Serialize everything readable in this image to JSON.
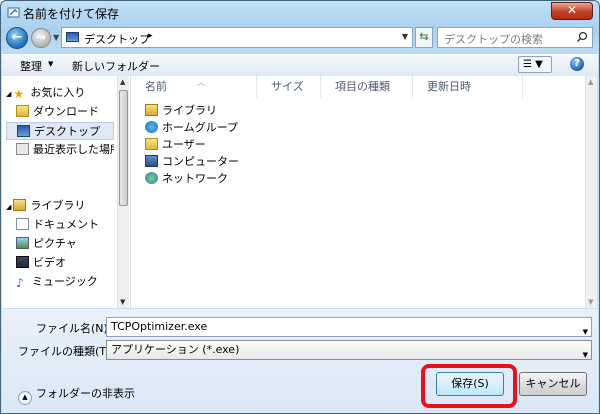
{
  "window": {
    "title": "名前を付けて保存",
    "close_label": "✕"
  },
  "address": {
    "location": "デスクトップ",
    "separator": "▸",
    "search_placeholder": "デスクトップの検索"
  },
  "toolbar": {
    "organize_label": "整理",
    "new_folder_label": "新しいフォルダー",
    "view_label": "☰",
    "help_label": "?"
  },
  "nav": {
    "favorites": [
      {
        "label": "お気に入り",
        "icon": "star-icon"
      },
      {
        "label": "ダウンロード",
        "icon": "download-folder-icon"
      },
      {
        "label": "デスクトップ",
        "icon": "desktop-icon",
        "selected": true
      },
      {
        "label": "最近表示した場所",
        "icon": "recent-places-icon"
      }
    ],
    "libraries": [
      {
        "label": "ライブラリ",
        "icon": "library-icon"
      },
      {
        "label": "ドキュメント",
        "icon": "documents-icon"
      },
      {
        "label": "ピクチャ",
        "icon": "pictures-icon"
      },
      {
        "label": "ビデオ",
        "icon": "videos-icon"
      },
      {
        "label": "ミュージック",
        "icon": "music-icon"
      }
    ]
  },
  "columns": [
    "名前",
    "サイズ",
    "項目の種類",
    "更新日時"
  ],
  "files": [
    {
      "label": "ライブラリ",
      "icon": "library-icon"
    },
    {
      "label": "ホームグループ",
      "icon": "homegroup-icon"
    },
    {
      "label": "ユーザー",
      "icon": "user-folder-icon"
    },
    {
      "label": "コンピューター",
      "icon": "computer-icon"
    },
    {
      "label": "ネットワーク",
      "icon": "network-icon"
    }
  ],
  "form": {
    "filename_label": "ファイル名(N):",
    "filename_value": "TCPOptimizer.exe",
    "filetype_label": "ファイルの種類(T):",
    "filetype_value": "アプリケーション (*.exe)",
    "hide_folders_label": "フォルダーの非表示",
    "save_label": "保存(S)",
    "cancel_label": "キャンセル"
  },
  "colors": {
    "highlight": "#e8101a",
    "accent": "#1d6db8"
  }
}
